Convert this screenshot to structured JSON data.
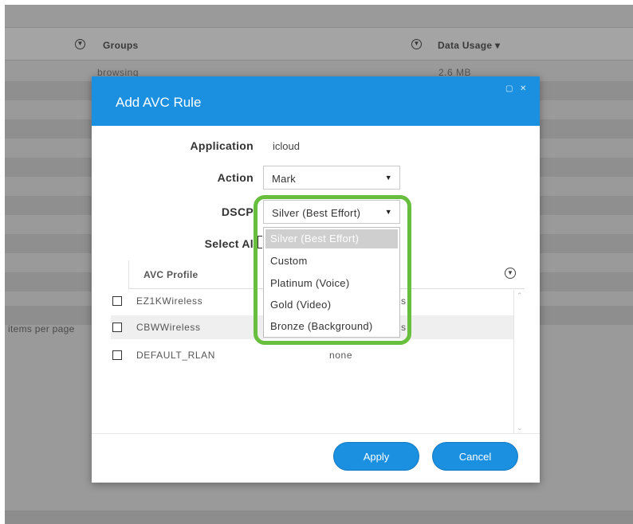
{
  "background": {
    "columns": {
      "groups": "Groups",
      "data_usage": "Data Usage ▾"
    },
    "row": {
      "group": "browsing",
      "usage": "2.6 MB"
    },
    "items_per_page": "items per page"
  },
  "modal": {
    "title": "Add AVC Rule",
    "application_label": "Application",
    "application_value": "icloud",
    "action_label": "Action",
    "action_value": "Mark",
    "dscp_label": "DSCP",
    "dscp_value": "Silver (Best Effort)",
    "select_all_label": "Select Al",
    "table": {
      "header": "AVC Profile",
      "rows": [
        {
          "name": "EZ1KWireless",
          "value": "s"
        },
        {
          "name": "CBWWireless",
          "value": "s"
        },
        {
          "name": "DEFAULT_RLAN",
          "value": "none"
        }
      ]
    },
    "apply_label": "Apply",
    "cancel_label": "Cancel"
  },
  "dscp_options": [
    "Silver (Best Effort)",
    "Custom",
    "Platinum (Voice)",
    "Gold (Video)",
    "Bronze (Background)"
  ],
  "colors": {
    "accent": "#1b8fe0",
    "highlight": "#67bf3d",
    "overlay": "#9a9a9a"
  }
}
